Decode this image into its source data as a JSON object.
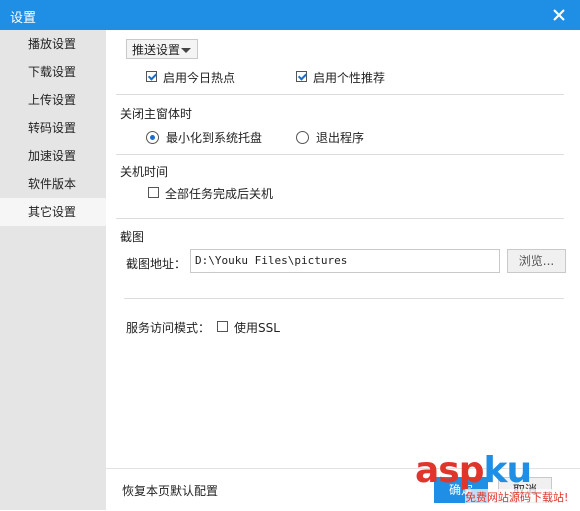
{
  "window": {
    "title": "设置"
  },
  "sidebar": {
    "items": [
      {
        "label": "播放设置"
      },
      {
        "label": "下载设置"
      },
      {
        "label": "上传设置"
      },
      {
        "label": "转码设置"
      },
      {
        "label": "加速设置"
      },
      {
        "label": "软件版本"
      },
      {
        "label": "其它设置",
        "active": true
      }
    ]
  },
  "push": {
    "dropdown_value": "推送设置",
    "hot_today": {
      "label": "启用今日热点",
      "checked": true
    },
    "personal_rec": {
      "label": "启用个性推荐",
      "checked": true
    }
  },
  "close_main": {
    "heading": "关闭主窗体时",
    "options": [
      {
        "label": "最小化到系统托盘",
        "selected": true
      },
      {
        "label": "退出程序",
        "selected": false
      }
    ]
  },
  "shutdown": {
    "heading": "关机时间",
    "option": {
      "label": "全部任务完成后关机",
      "checked": false
    }
  },
  "screenshot": {
    "heading": "截图",
    "path_label": "截图地址：",
    "path_value": "D:\\Youku Files\\pictures",
    "browse_label": "浏览..."
  },
  "service": {
    "mode_label": "服务访问模式：",
    "ssl": {
      "label": "使用SSL",
      "checked": false
    }
  },
  "footer": {
    "reset_label": "恢复本页默认配置",
    "ok_label": "确定",
    "cancel_label": "取消"
  },
  "watermark": {
    "logo": "asp",
    "logo_ku": "ku",
    "text": "免费网站源码下载站!"
  }
}
